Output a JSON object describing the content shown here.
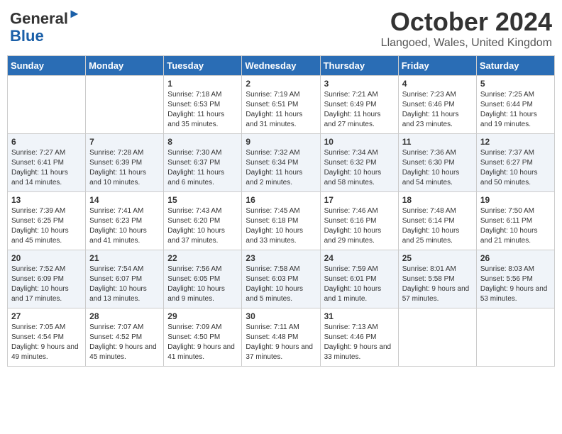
{
  "header": {
    "logo_line1": "General",
    "logo_line2": "Blue",
    "month_title": "October 2024",
    "location": "Llangoed, Wales, United Kingdom"
  },
  "days_of_week": [
    "Sunday",
    "Monday",
    "Tuesday",
    "Wednesday",
    "Thursday",
    "Friday",
    "Saturday"
  ],
  "weeks": [
    [
      {
        "day": "",
        "info": ""
      },
      {
        "day": "",
        "info": ""
      },
      {
        "day": "1",
        "info": "Sunrise: 7:18 AM\nSunset: 6:53 PM\nDaylight: 11 hours and 35 minutes."
      },
      {
        "day": "2",
        "info": "Sunrise: 7:19 AM\nSunset: 6:51 PM\nDaylight: 11 hours and 31 minutes."
      },
      {
        "day": "3",
        "info": "Sunrise: 7:21 AM\nSunset: 6:49 PM\nDaylight: 11 hours and 27 minutes."
      },
      {
        "day": "4",
        "info": "Sunrise: 7:23 AM\nSunset: 6:46 PM\nDaylight: 11 hours and 23 minutes."
      },
      {
        "day": "5",
        "info": "Sunrise: 7:25 AM\nSunset: 6:44 PM\nDaylight: 11 hours and 19 minutes."
      }
    ],
    [
      {
        "day": "6",
        "info": "Sunrise: 7:27 AM\nSunset: 6:41 PM\nDaylight: 11 hours and 14 minutes."
      },
      {
        "day": "7",
        "info": "Sunrise: 7:28 AM\nSunset: 6:39 PM\nDaylight: 11 hours and 10 minutes."
      },
      {
        "day": "8",
        "info": "Sunrise: 7:30 AM\nSunset: 6:37 PM\nDaylight: 11 hours and 6 minutes."
      },
      {
        "day": "9",
        "info": "Sunrise: 7:32 AM\nSunset: 6:34 PM\nDaylight: 11 hours and 2 minutes."
      },
      {
        "day": "10",
        "info": "Sunrise: 7:34 AM\nSunset: 6:32 PM\nDaylight: 10 hours and 58 minutes."
      },
      {
        "day": "11",
        "info": "Sunrise: 7:36 AM\nSunset: 6:30 PM\nDaylight: 10 hours and 54 minutes."
      },
      {
        "day": "12",
        "info": "Sunrise: 7:37 AM\nSunset: 6:27 PM\nDaylight: 10 hours and 50 minutes."
      }
    ],
    [
      {
        "day": "13",
        "info": "Sunrise: 7:39 AM\nSunset: 6:25 PM\nDaylight: 10 hours and 45 minutes."
      },
      {
        "day": "14",
        "info": "Sunrise: 7:41 AM\nSunset: 6:23 PM\nDaylight: 10 hours and 41 minutes."
      },
      {
        "day": "15",
        "info": "Sunrise: 7:43 AM\nSunset: 6:20 PM\nDaylight: 10 hours and 37 minutes."
      },
      {
        "day": "16",
        "info": "Sunrise: 7:45 AM\nSunset: 6:18 PM\nDaylight: 10 hours and 33 minutes."
      },
      {
        "day": "17",
        "info": "Sunrise: 7:46 AM\nSunset: 6:16 PM\nDaylight: 10 hours and 29 minutes."
      },
      {
        "day": "18",
        "info": "Sunrise: 7:48 AM\nSunset: 6:14 PM\nDaylight: 10 hours and 25 minutes."
      },
      {
        "day": "19",
        "info": "Sunrise: 7:50 AM\nSunset: 6:11 PM\nDaylight: 10 hours and 21 minutes."
      }
    ],
    [
      {
        "day": "20",
        "info": "Sunrise: 7:52 AM\nSunset: 6:09 PM\nDaylight: 10 hours and 17 minutes."
      },
      {
        "day": "21",
        "info": "Sunrise: 7:54 AM\nSunset: 6:07 PM\nDaylight: 10 hours and 13 minutes."
      },
      {
        "day": "22",
        "info": "Sunrise: 7:56 AM\nSunset: 6:05 PM\nDaylight: 10 hours and 9 minutes."
      },
      {
        "day": "23",
        "info": "Sunrise: 7:58 AM\nSunset: 6:03 PM\nDaylight: 10 hours and 5 minutes."
      },
      {
        "day": "24",
        "info": "Sunrise: 7:59 AM\nSunset: 6:01 PM\nDaylight: 10 hours and 1 minute."
      },
      {
        "day": "25",
        "info": "Sunrise: 8:01 AM\nSunset: 5:58 PM\nDaylight: 9 hours and 57 minutes."
      },
      {
        "day": "26",
        "info": "Sunrise: 8:03 AM\nSunset: 5:56 PM\nDaylight: 9 hours and 53 minutes."
      }
    ],
    [
      {
        "day": "27",
        "info": "Sunrise: 7:05 AM\nSunset: 4:54 PM\nDaylight: 9 hours and 49 minutes."
      },
      {
        "day": "28",
        "info": "Sunrise: 7:07 AM\nSunset: 4:52 PM\nDaylight: 9 hours and 45 minutes."
      },
      {
        "day": "29",
        "info": "Sunrise: 7:09 AM\nSunset: 4:50 PM\nDaylight: 9 hours and 41 minutes."
      },
      {
        "day": "30",
        "info": "Sunrise: 7:11 AM\nSunset: 4:48 PM\nDaylight: 9 hours and 37 minutes."
      },
      {
        "day": "31",
        "info": "Sunrise: 7:13 AM\nSunset: 4:46 PM\nDaylight: 9 hours and 33 minutes."
      },
      {
        "day": "",
        "info": ""
      },
      {
        "day": "",
        "info": ""
      }
    ]
  ]
}
